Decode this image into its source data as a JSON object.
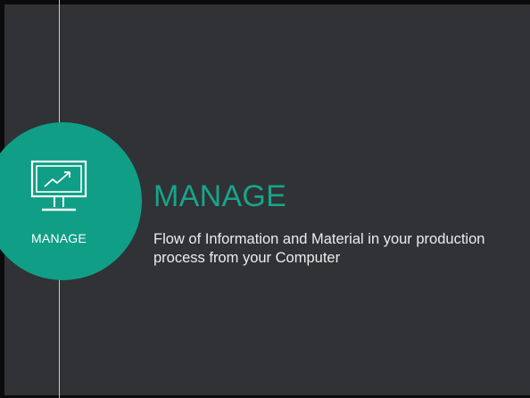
{
  "slide": {
    "badge_label": "MANAGE",
    "title": "MANAGE",
    "subtitle": "Flow of Information and Material in your production process from your Computer",
    "icon": "monitor-chart-icon"
  },
  "colors": {
    "background": "#313236",
    "accent": "#109f86",
    "title": "#17a58a",
    "text": "#ececec",
    "line": "#c9cacc"
  }
}
